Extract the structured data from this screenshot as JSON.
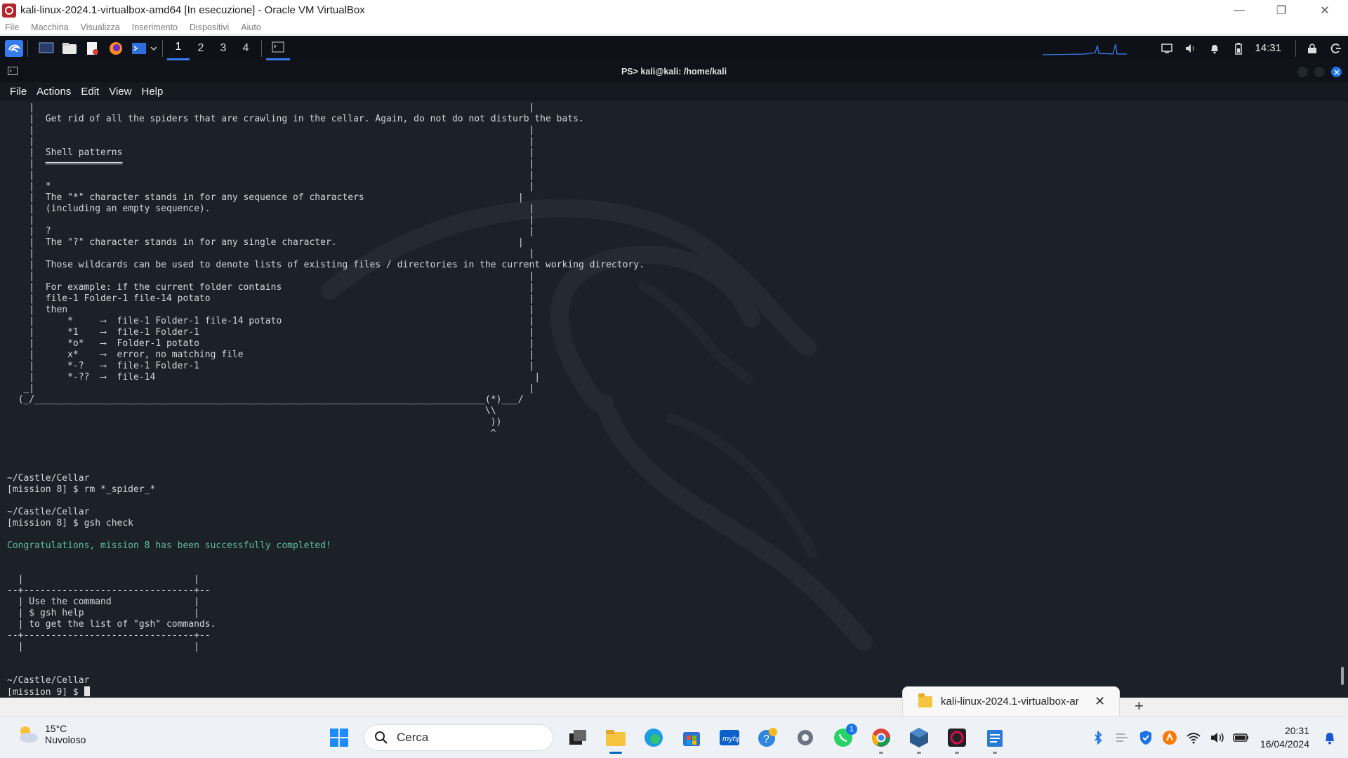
{
  "vbox": {
    "title": "kali-linux-2024.1-virtualbox-amd64 [In esecuzione] - Oracle VM VirtualBox",
    "menu": [
      "File",
      "Macchina",
      "Visualizza",
      "Inserimento",
      "Dispositivi",
      "Aiuto"
    ]
  },
  "kali_panel": {
    "workspaces": [
      "1",
      "2",
      "3",
      "4"
    ],
    "active_workspace": "1",
    "clock": "14:31"
  },
  "terminal": {
    "title": "PS> kali@kali: /home/kali",
    "menu": [
      "File",
      "Actions",
      "Edit",
      "View",
      "Help"
    ],
    "lines": [
      "    |                                                                                          |",
      "    |  Get rid of all the spiders that are crawling in the cellar. Again, do not do not disturb the bats.",
      "    |                                                                                          |",
      "    |                                                                                          |",
      "    |  Shell patterns                                                                          |",
      "    |  ══════════════                                                                          |",
      "    |                                                                                          |",
      "    |  *                                                                                       |",
      "    |  The \"*\" character stands in for any sequence of characters                            |",
      "    |  (including an empty sequence).                                                          |",
      "    |                                                                                          |",
      "    |  ?                                                                                       |",
      "    |  The \"?\" character stands in for any single character.                                 |",
      "    |                                                                                          |",
      "    |  Those wildcards can be used to denote lists of existing files / directories in the current working directory.",
      "    |                                                                                          |",
      "    |  For example: if the current folder contains                                             |",
      "    |  file-1 Folder-1 file-14 potato                                                          |",
      "    |  then                                                                                    |",
      "    |      *     ⟶  file-1 Folder-1 file-14 potato                                             |",
      "    |      *1    ⟶  file-1 Folder-1                                                            |",
      "    |      *o*   ⟶  Folder-1 potato                                                            |",
      "    |      x*    ⟶  error, no matching file                                                    |",
      "    |      *-?   ⟶  file-1 Folder-1                                                            |",
      "    |      *-??  ⟶  file-14                                                                     |",
      "   _|                                                                                          |",
      "  (_/__________________________________________________________________________________(*)___/",
      "                                                                                       \\\\",
      "                                                                                        ))",
      "                                                                                        ^",
      "",
      "",
      "",
      "~/Castle/Cellar",
      "[mission 8] $ rm *_spider_*",
      "",
      "~/Castle/Cellar",
      "[mission 8] $ gsh check",
      "",
      "Congratulations, mission 8 has been successfully completed!",
      "",
      "",
      "  |                               |",
      "--+-------------------------------+--",
      "  | Use the command               |",
      "  | $ gsh help                    |",
      "  | to get the list of \"gsh\" commands.",
      "--+-------------------------------+--",
      "  |                               |",
      "",
      "",
      "~/Castle/Cellar",
      "[mission 9] $ "
    ],
    "green_line_index": 39,
    "cursor_line_index": 52
  },
  "explorer_tab": {
    "label": "kali-linux-2024.1-virtualbox-ar",
    "close": "✕",
    "new_tab": "+"
  },
  "taskbar": {
    "weather_temp": "15°C",
    "weather_desc": "Nuvoloso",
    "search_placeholder": "Cerca",
    "whatsapp_badge": "1",
    "clock_time": "20:31",
    "clock_date": "16/04/2024"
  },
  "colors": {
    "terminal_bg": "#1c2028",
    "terminal_fg": "#d3d7de",
    "success_green": "#5fbfa3",
    "accent_blue": "#367bf0"
  },
  "icons": [
    "kali-menu-icon",
    "desktop-icon",
    "file-manager-icon",
    "text-editor-icon",
    "firefox-icon",
    "terminal-icon",
    "chevron-down-icon",
    "window-icon",
    "display-icon",
    "volume-icon",
    "bell-icon",
    "battery-icon",
    "lock-icon",
    "logout-icon",
    "windows-start-icon",
    "search-icon",
    "task-view-icon",
    "explorer-icon",
    "edge-icon",
    "store-icon",
    "myhp-icon",
    "help-icon",
    "settings-icon",
    "whatsapp-icon",
    "chrome-icon",
    "virtualbox-icon",
    "debian-icon",
    "notepad-icon",
    "bluetooth-icon",
    "security-icon",
    "avast-icon",
    "wifi-icon",
    "speaker-icon",
    "battery-icon",
    "notifications-icon"
  ]
}
